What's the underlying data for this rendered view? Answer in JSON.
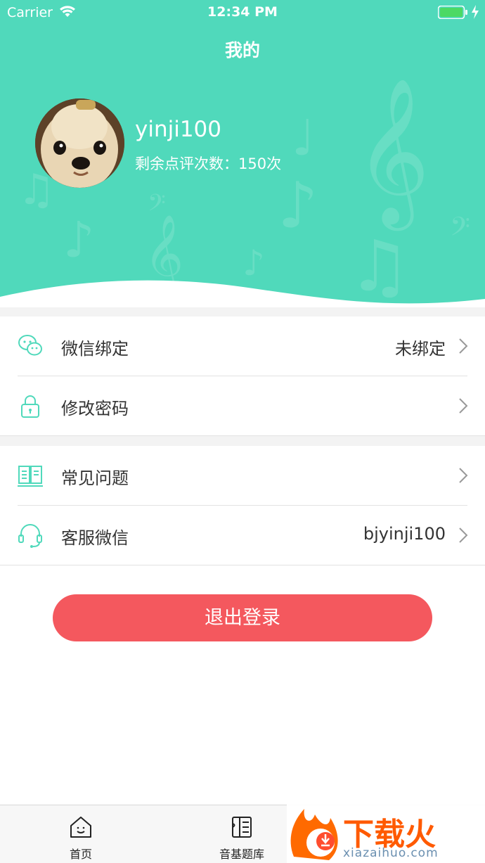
{
  "status_bar": {
    "carrier": "Carrier",
    "time": "12:34 PM"
  },
  "header": {
    "title": "我的",
    "username": "yinji100",
    "remaining": "剩余点评次数：150次"
  },
  "settings": {
    "wechat_bind": {
      "label": "微信绑定",
      "value": "未绑定",
      "icon": "wechat-icon"
    },
    "change_password": {
      "label": "修改密码",
      "icon": "lock-icon"
    },
    "faq": {
      "label": "常见问题",
      "icon": "book-icon"
    },
    "service_wechat": {
      "label": "客服微信",
      "value": "bjyinji100",
      "icon": "headset-icon"
    }
  },
  "logout": {
    "label": "退出登录"
  },
  "tabs": [
    {
      "label": "首页",
      "icon": "home-icon"
    },
    {
      "label": "音基题库",
      "icon": "question-bank-icon"
    }
  ],
  "watermark": {
    "text": "下载火",
    "url": "xiazaihuo.com"
  },
  "colors": {
    "accent": "#50d9bb",
    "logout": "#f4585e",
    "watermark": "#ff5a00"
  }
}
